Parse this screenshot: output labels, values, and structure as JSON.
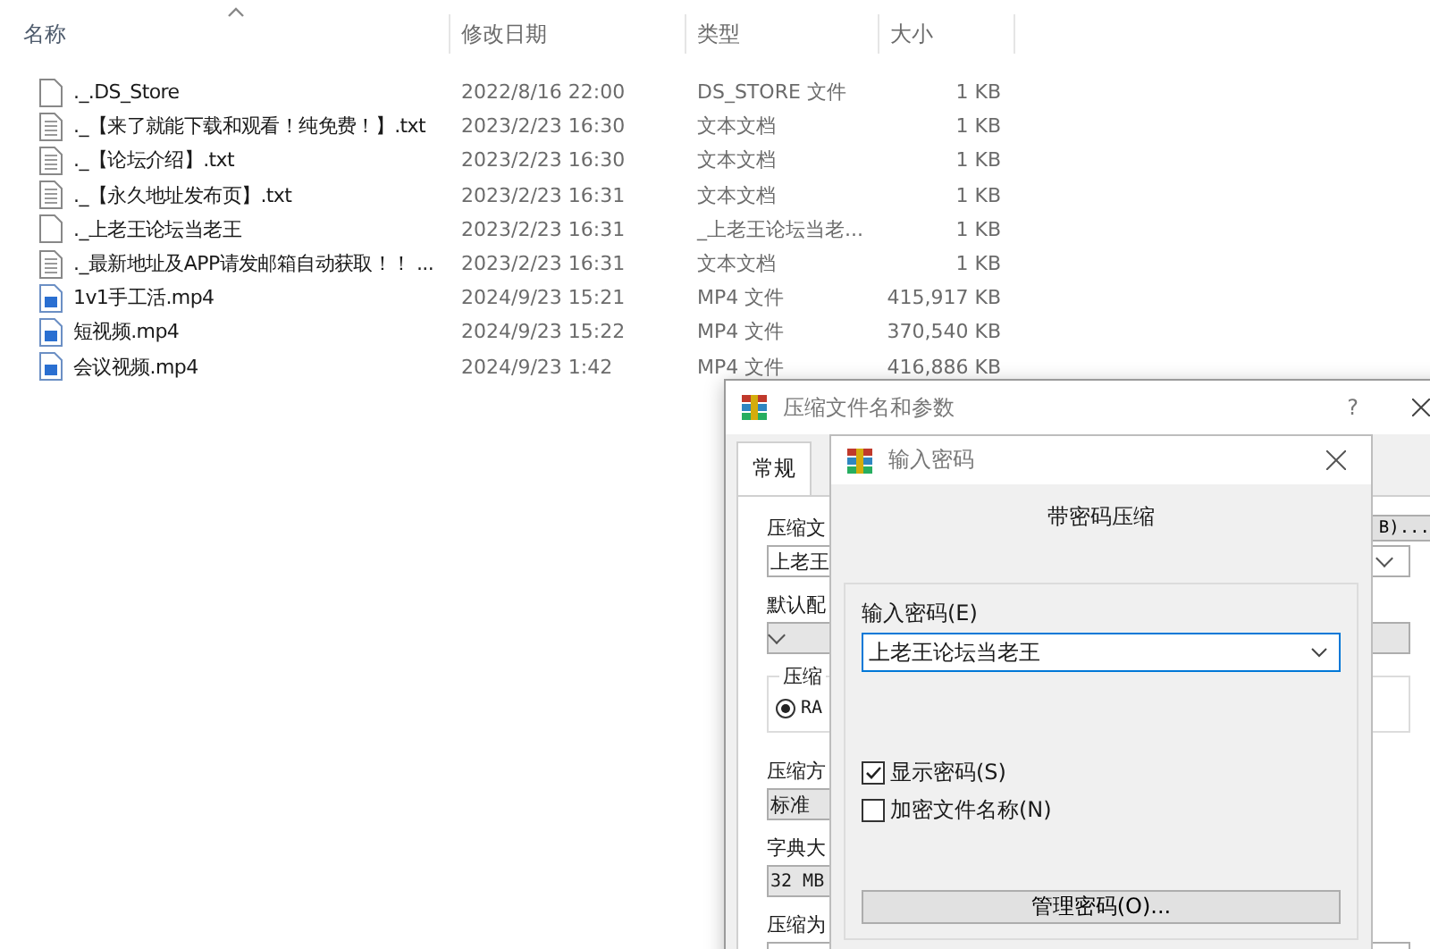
{
  "file_list": {
    "columns": [
      "名称",
      "修改日期",
      "类型",
      "大小"
    ],
    "rows": [
      {
        "kind": "file",
        "name": "._.DS_Store",
        "date": "2022/8/16 22:00",
        "type": "DS_STORE 文件",
        "size": "1 KB"
      },
      {
        "kind": "text",
        "name": "._【来了就能下载和观看！纯免费！】.txt",
        "date": "2023/2/23 16:30",
        "type": "文本文档",
        "size": "1 KB"
      },
      {
        "kind": "text",
        "name": "._【论坛介绍】.txt",
        "date": "2023/2/23 16:30",
        "type": "文本文档",
        "size": "1 KB"
      },
      {
        "kind": "text",
        "name": "._【永久地址发布页】.txt",
        "date": "2023/2/23 16:31",
        "type": "文本文档",
        "size": "1 KB"
      },
      {
        "kind": "file",
        "name": "._上老王论坛当老王",
        "date": "2023/2/23 16:31",
        "type": "_上老王论坛当老...",
        "size": "1 KB"
      },
      {
        "kind": "text",
        "name": "._最新地址及APP请发邮箱自动获取！！ ...",
        "date": "2023/2/23 16:31",
        "type": "文本文档",
        "size": "1 KB"
      },
      {
        "kind": "video",
        "name": "1v1手工活.mp4",
        "date": "2024/9/23 15:21",
        "type": "MP4 文件",
        "size": "415,917 KB"
      },
      {
        "kind": "video",
        "name": "短视频.mp4",
        "date": "2024/9/23 15:22",
        "type": "MP4 文件",
        "size": "370,540 KB"
      },
      {
        "kind": "video",
        "name": "会议视频.mp4",
        "date": "2024/9/23 1:42",
        "type": "MP4 文件",
        "size": "416,886 KB"
      }
    ]
  },
  "archive_dialog": {
    "title": "压缩文件名和参数",
    "help": "?",
    "tabs": [
      {
        "label": "常规",
        "selected": true
      }
    ],
    "archive_label": "压缩文",
    "browse_button": "B)...",
    "archive_value": "上老王",
    "profile_label": "默认配",
    "format_group": "压缩",
    "format_option": {
      "label": "RA",
      "selected": true
    },
    "method_label": "压缩方",
    "method_value": "标准",
    "dict_label": "字典大",
    "dict_value": "32 MB",
    "split_label": "压缩为"
  },
  "password_dialog": {
    "title": "输入密码",
    "heading": "带密码压缩",
    "password_label": "输入密码(E)",
    "password_value": "上老王论坛当老王",
    "options": [
      {
        "label": "显示密码(S)",
        "checked": true
      },
      {
        "label": "加密文件名称(N)",
        "checked": false
      }
    ],
    "manage_button": "管理密码(O)..."
  }
}
